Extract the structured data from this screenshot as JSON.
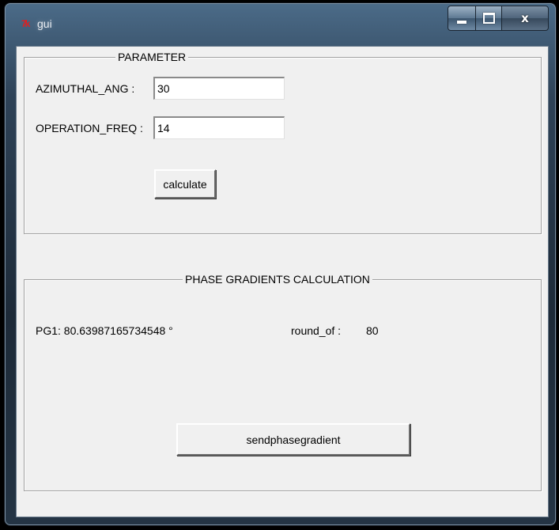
{
  "window": {
    "title": "gui",
    "app_icon": "tk-feather-icon",
    "controls": {
      "minimize": "minimize-icon",
      "maximize": "maximize-icon",
      "close": "x"
    }
  },
  "parameter": {
    "legend": "PARAMETER",
    "azimuthal_label": "AZIMUTHAL_ANG :",
    "azimuthal_value": "30",
    "freq_label": "OPERATION_FREQ :",
    "freq_value": "14",
    "calculate_label": "calculate"
  },
  "phase": {
    "legend": "PHASE GRADIENTS CALCULATION",
    "pg1_text": "PG1:  80.63987165734548 °",
    "round_label": "round_of :",
    "round_value": "80",
    "send_label": "sendphasegradient"
  }
}
